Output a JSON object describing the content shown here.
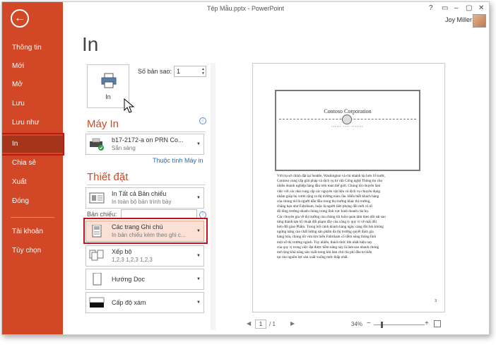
{
  "window": {
    "title": "Tệp Mẫu.pptx - PowerPoint",
    "controls": [
      "?",
      "▭",
      "–",
      "▢",
      "✕"
    ],
    "user_name": "Joy Miller"
  },
  "sidebar": {
    "items": [
      {
        "label": "Thông tin"
      },
      {
        "label": "Mới"
      },
      {
        "label": "Mở"
      },
      {
        "label": "Lưu"
      },
      {
        "label": "Lưu như"
      },
      {
        "label": "In",
        "active": true
      },
      {
        "label": "Chia sẻ"
      },
      {
        "label": "Xuất"
      },
      {
        "label": "Đóng"
      },
      {
        "label": "Tài khoản"
      },
      {
        "label": "Tùy chọn"
      }
    ]
  },
  "main": {
    "heading": "In",
    "print_button_label": "In",
    "copies_label": "Số bản sao:",
    "copies_value": "1",
    "printer_section": "Máy In",
    "printer_name": "b17-2172-a on PRN Co...",
    "printer_status": "Sẵn sàng",
    "printer_properties_link": "Thuộc tính Máy in",
    "settings_section": "Thiết đặt",
    "settings": [
      {
        "line1": "In Tất cả Bản chiếu",
        "line2": "In toàn bộ bản trình bày"
      },
      {
        "line1": "Các trang Ghi chú",
        "line2": "In bản chiếu kèm theo ghi c..."
      },
      {
        "line1": "Xếp bộ",
        "line2": "1,2,3    1,2,3    1,2,3"
      },
      {
        "line1": "Hướng Dọc",
        "line2": ""
      },
      {
        "line1": "Cấp độ xám",
        "line2": ""
      }
    ],
    "slides_label": "Bản chiếu:"
  },
  "preview": {
    "slide_title": "Contoso Corporation",
    "slide_subtitle": "▪▪▪▪▪▪ ▪▪▪▪ ▪▪▪▪▪▪▪",
    "notes_lines": [
      "Với trụ sở chính đặt tại Seattle, Washington và chi nhánh tại hơn 10 nước,",
      "Contoso cung cấp giải pháp và dịch vụ tư vấn Công nghệ Thông tin cho",
      "nhiều doanh nghiệp hàng đầu trên toàn thế giới. Chúng tôi chuyên làm",
      "việc với các nhà cung cấp các nguyên vật liệu và dịch vụ chuyên dụng",
      "nhằm giúp họ vươn rộng ra thị trường toàn cầu. Hiểu biết khách hàng",
      " của chúng tôi là người dẫn đầu trong thị trường khác thị trường,",
      " chẳng hạn như Fabrikam, hoặc là người tiên phong đổi mới có tổ",
      "đô tổng trưởng nhanh chóng trong lĩnh vực kinh doanh của họ.",
      "Các chuyên gia về thị trường của chúng tôi luôn quan tâm theo dõi sát sao",
      " từng thành tựu kỹ thuật đổi phạm đầy của công ty quy vi về mặt đổi",
      "hơn đối giao Phẩm. Trong bối cảnh khách hàng ngày càng đòi hỏi không",
      " ngừng nâng cao chất lượng sản phẩm đa thị trường quyết định gia",
      "hàng hóa, chúng tôi vừa tìm hiểu Fabrikam có tiềm năng thông lĩnh",
      " một số thị trường ngách.  Tuy nhiên, thách thức lớn nhất hiện nay",
      " của quy vị trong việc đạt được tiềm năng này là làm sao nhanh chóng",
      " mở rộng khả năng sản xuất trong khi làm chủ chi phí đầu tư biến",
      "tại vào nguồn lực sản xuất xuống mức thấp nhất."
    ],
    "page_number_corner": "3",
    "current_page": "1",
    "total_pages": "/ 1",
    "zoom": "34%"
  }
}
